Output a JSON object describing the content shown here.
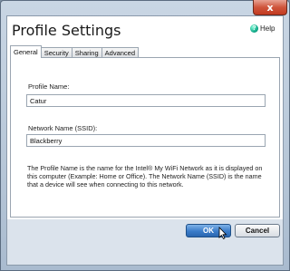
{
  "window": {
    "close_label": "x",
    "title": "Profile Settings",
    "help_label": "Help",
    "help_icon": "help-icon"
  },
  "tabs": [
    {
      "label": "General",
      "active": true
    },
    {
      "label": "Security",
      "active": false
    },
    {
      "label": "Sharing",
      "active": false
    },
    {
      "label": "Advanced",
      "active": false
    }
  ],
  "general": {
    "profile_name_label": "Profile Name:",
    "profile_name_value": "Catur",
    "network_name_label": "Network Name (SSID):",
    "network_name_value": "Blackberry",
    "description": "The Profile Name is the name for the Intel® My WiFi Network as it is displayed on this computer (Example: Home or Office).  The Network Name (SSID) is the name that a device will see when connecting to this network."
  },
  "buttons": {
    "ok_label": "OK",
    "cancel_label": "Cancel"
  }
}
